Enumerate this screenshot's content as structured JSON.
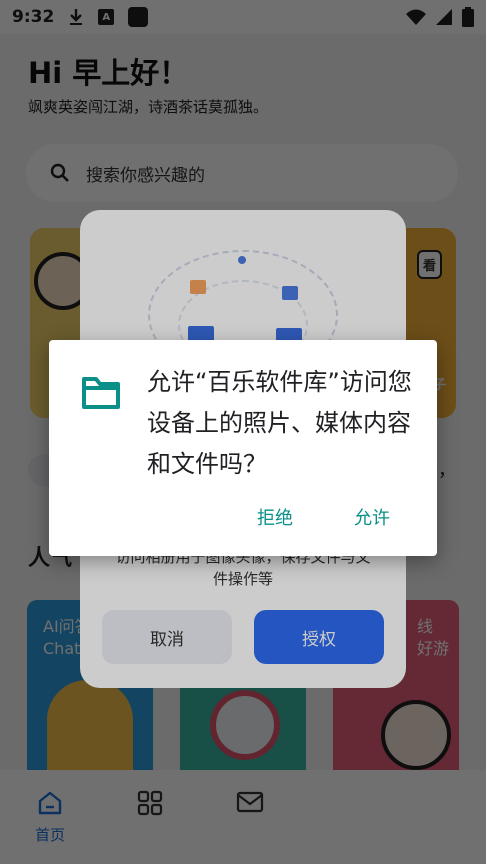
{
  "status_bar": {
    "time": "9:32",
    "notification_icons": [
      "download-icon",
      "a-icon",
      "square-icon"
    ],
    "system_icons": [
      "wifi-icon",
      "signal-icon",
      "battery-icon"
    ]
  },
  "header": {
    "greeting": "Hi 早上好！",
    "slogan": "飒爽英姿闯江湖，诗酒茶话莫孤独。"
  },
  "search": {
    "placeholder": "搜索你感兴趣的"
  },
  "banner": {
    "tag_visible": "看",
    "tag_bottom": "子"
  },
  "notice": {
    "partial_text": "行，"
  },
  "section": {
    "title": "人气"
  },
  "cards": [
    {
      "title_line1": "AI问答",
      "title_line2": "ChatG"
    },
    {
      "title_line1": "",
      "title_line2": ""
    },
    {
      "title_line1": "线",
      "title_line2": "好游"
    }
  ],
  "bottom_nav": {
    "items": [
      {
        "label": "首页",
        "icon": "home-icon",
        "active": true
      },
      {
        "label": "",
        "icon": "grid-icon",
        "active": false
      },
      {
        "label": "",
        "icon": "mail-icon",
        "active": false
      }
    ]
  },
  "app_permission_dialog": {
    "description_line1": "访问相册用于图像头像，保存文件与文",
    "description_line2": "件操作等",
    "cancel_label": "取消",
    "authorize_label": "授权"
  },
  "system_permission_dialog": {
    "message": "允许“百乐软件库”访问您设备上的照片、媒体内容和文件吗？",
    "deny_label": "拒绝",
    "allow_label": "允许",
    "accent_color": "#0a8f89"
  }
}
